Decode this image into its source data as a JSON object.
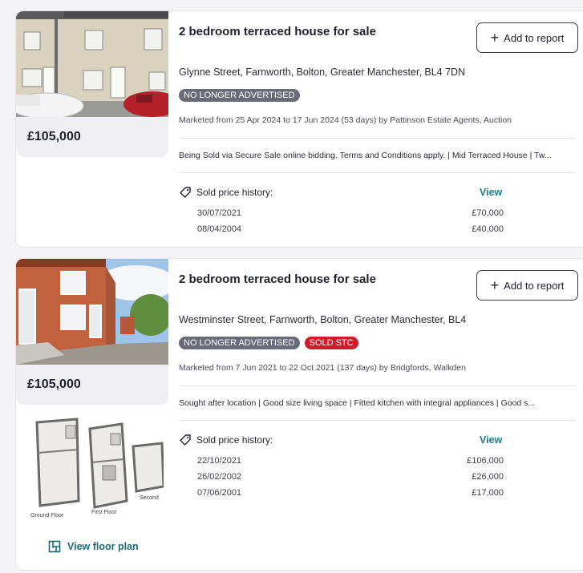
{
  "listings": [
    {
      "price": "£105,000",
      "title": "2 bedroom terraced house for sale",
      "add_label": "Add to report",
      "address": "Glynne Street, Farnworth, Bolton, Greater Manchester, BL4 7DN",
      "badges": [
        "NO LONGER ADVERTISED"
      ],
      "marketed": "Marketed from 25 Apr 2024 to 17 Jun 2024 (53 days) by Pattinson Estate Agents, Auction",
      "description": "Being Sold via Secure Sale online bidding. Terms and Conditions apply. | Mid Terraced House | Tw...",
      "history_label": "Sold price history:",
      "view_label": "View",
      "history": [
        {
          "date": "30/07/2021",
          "amount": "£70,000"
        },
        {
          "date": "08/04/2004",
          "amount": "£40,000"
        }
      ]
    },
    {
      "price": "£105,000",
      "title": "2 bedroom terraced house for sale",
      "add_label": "Add to report",
      "address": "Westminster Street, Farnworth, Bolton, Greater Manchester, BL4",
      "badges": [
        "NO LONGER ADVERTISED",
        "SOLD STC"
      ],
      "marketed": "Marketed from 7 Jun 2021 to 22 Oct 2021 (137 days) by Bridgfords, Walkden",
      "description": "Sought after location | Good size living space | Fitted kitchen with integral appliances | Good s...",
      "history_label": "Sold price history:",
      "view_label": "View",
      "history": [
        {
          "date": "22/10/2021",
          "amount": "£106,000"
        },
        {
          "date": "26/02/2002",
          "amount": "£26,000"
        },
        {
          "date": "07/06/2001",
          "amount": "£17,000"
        }
      ],
      "floorplan": {
        "link_label": "View floor plan",
        "floor_labels": [
          "Ground Floor",
          "First Floor",
          "Second"
        ]
      }
    }
  ],
  "colors": {
    "accent": "#1a7f86",
    "badge_grey": "#6a6a78",
    "badge_red": "#d11a2a"
  }
}
